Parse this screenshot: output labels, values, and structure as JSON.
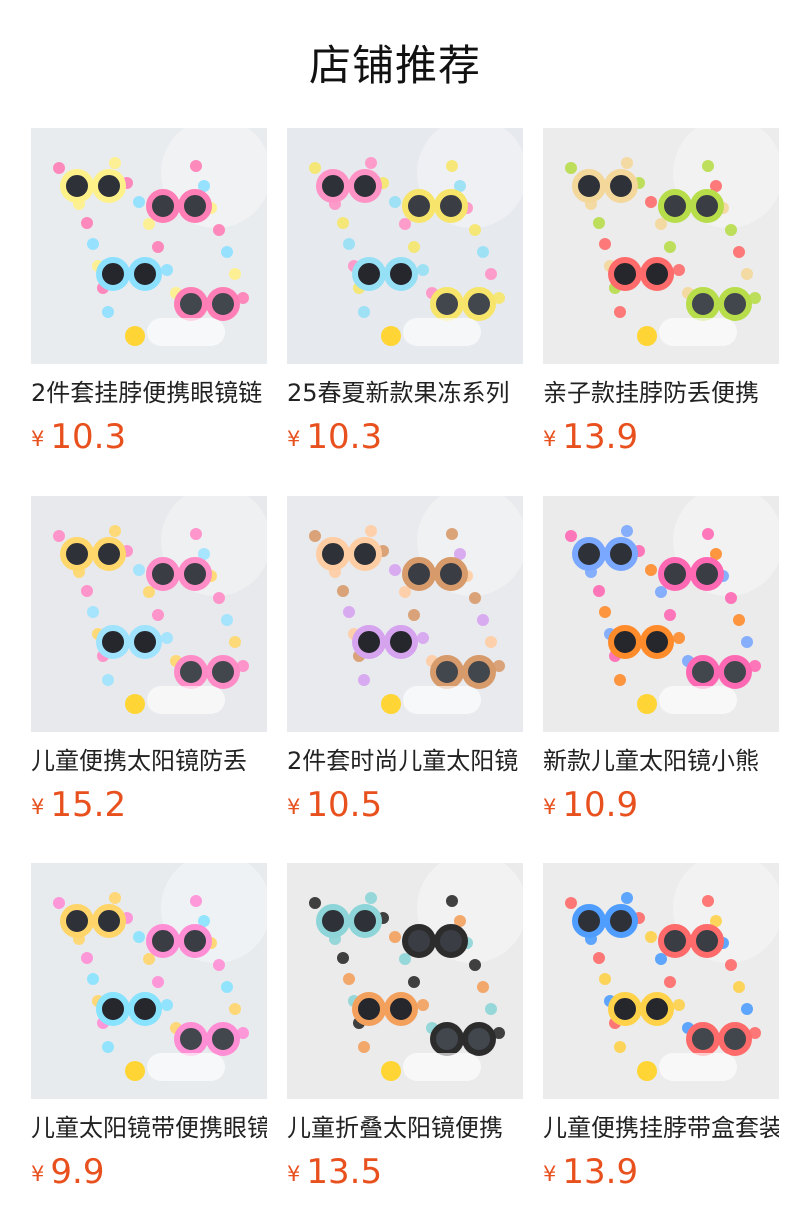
{
  "page": {
    "title": "店铺推荐",
    "accent_color": "#e8501d"
  },
  "products": [
    {
      "name": "2件套挂脖便携眼镜链",
      "currency": "¥",
      "price": "10.3",
      "image": {
        "icon": "kids-sunglasses-chain-photo",
        "bg": "#e9ecef",
        "c1": "#ff7eb6",
        "c2": "#8ce0ff",
        "c3": "#fff18a"
      }
    },
    {
      "name": "25春夏新款果冻系列",
      "currency": "¥",
      "price": "10.3",
      "image": {
        "icon": "jelly-sunglasses-photo",
        "bg": "#e6e9ee",
        "c1": "#f6e56a",
        "c2": "#96e0f5",
        "c3": "#ff93c5"
      }
    },
    {
      "name": "亲子款挂脖防丢便携",
      "currency": "¥",
      "price": "13.9",
      "image": {
        "icon": "family-sunglasses-photo",
        "bg": "#ececec",
        "c1": "#b7dd4a",
        "c2": "#ff6b6b",
        "c3": "#f4d79a"
      }
    },
    {
      "name": "儿童便携太阳镜防丢",
      "currency": "¥",
      "price": "15.2",
      "image": {
        "icon": "kids-sunglasses-case-photo",
        "bg": "#e7e9ec",
        "c1": "#ff8cc6",
        "c2": "#9fe3ff",
        "c3": "#ffd76a"
      }
    },
    {
      "name": "2件套时尚儿童太阳镜",
      "currency": "¥",
      "price": "10.5",
      "image": {
        "icon": "fashion-kids-sunglasses-photo",
        "bg": "#e9eaed",
        "c1": "#d79a6a",
        "c2": "#d6a4ef",
        "c3": "#ffcda3"
      }
    },
    {
      "name": "新款儿童太阳镜小熊",
      "currency": "¥",
      "price": "10.9",
      "image": {
        "icon": "bear-sunglasses-photo",
        "bg": "#ebebeb",
        "c1": "#ff69b4",
        "c2": "#ff8b2b",
        "c3": "#7aa7ff"
      }
    },
    {
      "name": "儿童太阳镜带便携眼镜",
      "currency": "¥",
      "price": "9.9",
      "image": {
        "icon": "rainbow-sunglasses-photo",
        "bg": "#e7ebee",
        "c1": "#ff8ed5",
        "c2": "#88e3ff",
        "c3": "#ffd56a"
      }
    },
    {
      "name": "儿童折叠太阳镜便携",
      "currency": "¥",
      "price": "13.5",
      "image": {
        "icon": "folding-sunglasses-photo",
        "bg": "#ebebeb",
        "c1": "#2c2c2c",
        "c2": "#f3a05d",
        "c3": "#8dd5d8"
      }
    },
    {
      "name": "儿童便携挂脖带盒套装",
      "currency": "¥",
      "price": "13.9",
      "image": {
        "icon": "case-lanyard-sunglasses-photo",
        "bg": "#ececec",
        "c1": "#ff6a6a",
        "c2": "#ffd24a",
        "c3": "#4f9dff"
      }
    }
  ]
}
